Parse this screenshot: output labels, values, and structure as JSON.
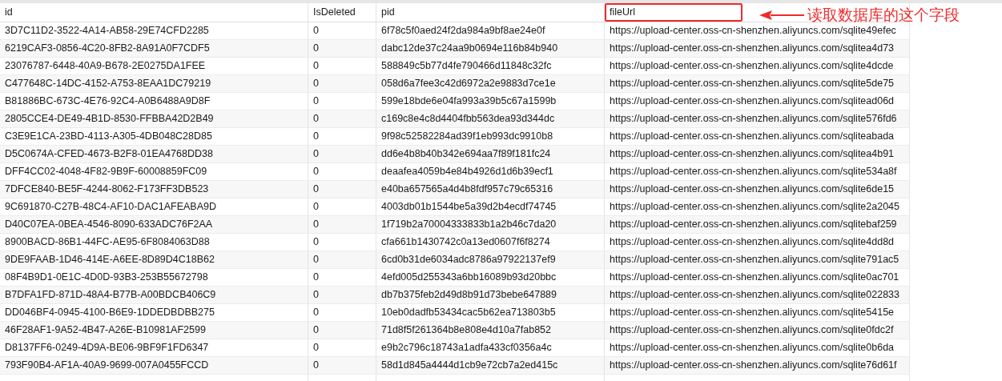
{
  "table": {
    "columns": [
      {
        "label": "id",
        "highlighted": false
      },
      {
        "label": "IsDeleted",
        "highlighted": false
      },
      {
        "label": "pid",
        "highlighted": false
      },
      {
        "label": "fileUrl",
        "highlighted": true
      }
    ],
    "rows": [
      {
        "cells": [
          "3D7C11D2-3522-4A14-AB58-29E74CFD2285",
          "0",
          "6f78c5f0aed24f2da984a9bf8ae24e0f",
          "https://upload-center.oss-cn-shenzhen.aliyuncs.com/sqlite49efec"
        ]
      },
      {
        "cells": [
          "6219CAF3-0856-4C20-8FB2-8A91A0F7CDF5",
          "0",
          "dabc12de37c24aa9b0694e116b84b940",
          "https://upload-center.oss-cn-shenzhen.aliyuncs.com/sqlitea4d73"
        ]
      },
      {
        "cells": [
          "23076787-6448-40A9-B678-2E0275DA1FEE",
          "0",
          "588849c5b77d4fe790466d11848c32fc",
          "https://upload-center.oss-cn-shenzhen.aliyuncs.com/sqlite4dcde"
        ]
      },
      {
        "cells": [
          "C477648C-14DC-4152-A753-8EAA1DC79219",
          "0",
          "058d6a7fee3c42d6972a2e9883d7ce1e",
          "https://upload-center.oss-cn-shenzhen.aliyuncs.com/sqlite5de75"
        ]
      },
      {
        "cells": [
          "B81886BC-673C-4E76-92C4-A0B6488A9D8F",
          "0",
          "599e18bde6e04fa993a39b5c67a1599b",
          "https://upload-center.oss-cn-shenzhen.aliyuncs.com/sqlitead06d"
        ]
      },
      {
        "cells": [
          "2805CCE4-DE49-4B1D-8530-FFBBA42D2B49",
          "0",
          "c169c8e4c8d4404fbb563dea93d344dc",
          "https://upload-center.oss-cn-shenzhen.aliyuncs.com/sqlite576fd6"
        ]
      },
      {
        "cells": [
          "C3E9E1CA-23BD-4113-A305-4DB048C28D85",
          "0",
          "9f98c52582284ad39f1eb993dc9910b8",
          "https://upload-center.oss-cn-shenzhen.aliyuncs.com/sqliteabada"
        ]
      },
      {
        "cells": [
          "D5C0674A-CFED-4673-B2F8-01EA4768DD38",
          "0",
          "dd6e4b8b40b342e694aa7f89f181fc24",
          "https://upload-center.oss-cn-shenzhen.aliyuncs.com/sqlitea4b91"
        ]
      },
      {
        "cells": [
          "DFF4CC02-4048-4F82-9B9F-60008859FC09",
          "0",
          "deaafea4059b4e84b4926d1d6b39ecf1",
          "https://upload-center.oss-cn-shenzhen.aliyuncs.com/sqlite534a8f"
        ]
      },
      {
        "cells": [
          "7DFCE840-BE5F-4244-8062-F173FF3DB523",
          "0",
          "e40ba657565a4d4b8fdf957c79c65316",
          "https://upload-center.oss-cn-shenzhen.aliyuncs.com/sqlite6de15"
        ]
      },
      {
        "cells": [
          "9C691870-C27B-48C4-AF10-DAC1AFEABA9D",
          "0",
          "4003db01b1544be5a39d2b4ecdf74745",
          "https://upload-center.oss-cn-shenzhen.aliyuncs.com/sqlite2a2045"
        ]
      },
      {
        "cells": [
          "D40C07EA-0BEA-4546-8090-633ADC76F2AA",
          "0",
          "1f719b2a70004333833b1a2b46c7da20",
          "https://upload-center.oss-cn-shenzhen.aliyuncs.com/sqlitebaf259"
        ]
      },
      {
        "cells": [
          "8900BACD-86B1-44FC-AE95-6F8084063D88",
          "0",
          "cfa661b1430742c0a13ed0607f6f8274",
          "https://upload-center.oss-cn-shenzhen.aliyuncs.com/sqlite4dd8d"
        ]
      },
      {
        "cells": [
          "9DE9FAAB-1D46-414E-A6EE-8D89D4C18B62",
          "0",
          "6cd0b31de6034adc8786a97922137ef9",
          "https://upload-center.oss-cn-shenzhen.aliyuncs.com/sqlite791ac5"
        ]
      },
      {
        "cells": [
          "08F4B9D1-0E1C-4D0D-93B3-253B55672798",
          "0",
          "4efd005d255343a6bb16089b93d20bbc",
          "https://upload-center.oss-cn-shenzhen.aliyuncs.com/sqlite0ac701"
        ]
      },
      {
        "cells": [
          "B7DFA1FD-871D-48A4-B77B-A00BDCB406C9",
          "0",
          "db7b375feb2d49d8b91d73bebe647889",
          "https://upload-center.oss-cn-shenzhen.aliyuncs.com/sqlite022833"
        ]
      },
      {
        "cells": [
          "DD046BF4-0945-4100-B6E9-1DDEDBDBB275",
          "0",
          "10eb0dadfb53434cac5b62ea713803b5",
          "https://upload-center.oss-cn-shenzhen.aliyuncs.com/sqlite5415e"
        ]
      },
      {
        "cells": [
          "46F28AF1-9A52-4B47-A26E-B10981AF2599",
          "0",
          "71d8f5f261364b8e808e4d10a7fab852",
          "https://upload-center.oss-cn-shenzhen.aliyuncs.com/sqlite0fdc2f"
        ]
      },
      {
        "cells": [
          "D8137FF6-0249-4D9A-BE06-9BF9F1FD6347",
          "0",
          "e9b2c796c18743a1adfa433cf0356a4c",
          "https://upload-center.oss-cn-shenzhen.aliyuncs.com/sqlite0b6da"
        ]
      },
      {
        "cells": [
          "793F90B4-AF1A-40A9-9699-007A0455FCCD",
          "0",
          "58d1d845a4444d1cb9e72cb7a2ed415c",
          "https://upload-center.oss-cn-shenzhen.aliyuncs.com/sqlite76d61f"
        ]
      }
    ]
  },
  "annotation": {
    "label": "读取数据库的这个字段"
  }
}
